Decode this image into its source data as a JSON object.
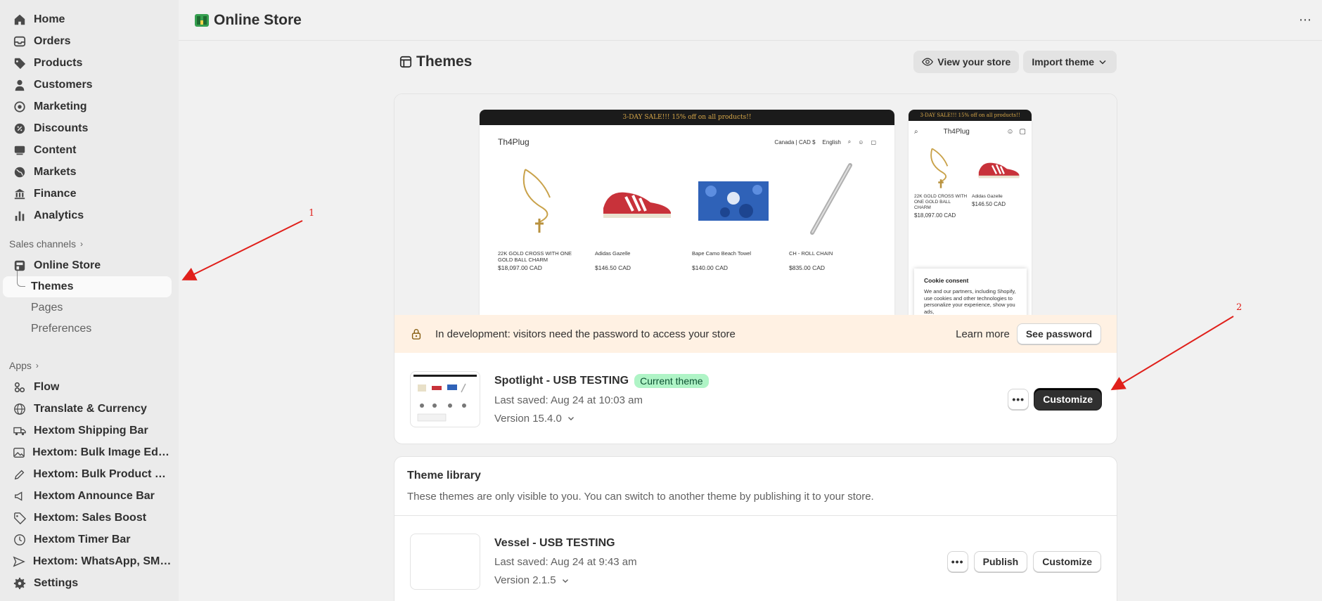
{
  "sidebar": {
    "main_items": [
      {
        "label": "Home",
        "icon": "home-icon"
      },
      {
        "label": "Orders",
        "icon": "orders-icon"
      },
      {
        "label": "Products",
        "icon": "tag-icon"
      },
      {
        "label": "Customers",
        "icon": "person-icon"
      },
      {
        "label": "Marketing",
        "icon": "target-icon"
      },
      {
        "label": "Discounts",
        "icon": "discount-icon"
      },
      {
        "label": "Content",
        "icon": "content-icon"
      },
      {
        "label": "Markets",
        "icon": "globe-icon"
      },
      {
        "label": "Finance",
        "icon": "bank-icon"
      },
      {
        "label": "Analytics",
        "icon": "bar-chart-icon"
      }
    ],
    "sales_channels_label": "Sales channels",
    "online_store_label": "Online Store",
    "sub_items": [
      "Themes",
      "Pages",
      "Preferences"
    ],
    "apps_label": "Apps",
    "apps": [
      "Flow",
      "Translate & Currency",
      "Hextom Shipping Bar",
      "Hextom: Bulk Image Edit &...",
      "Hextom: Bulk Product Edit",
      "Hextom Announce Bar",
      "Hextom: Sales Boost",
      "Hextom Timer Bar",
      "Hextom: WhatsApp, SMS ..."
    ],
    "settings_label": "Settings"
  },
  "topbar": {
    "title": "Online Store",
    "more": "⋯"
  },
  "page": {
    "title": "Themes",
    "view_store_label": "View your store",
    "import_theme_label": "Import theme"
  },
  "preview": {
    "announcement": "3-DAY SALE!!! 15% off on all products!!",
    "store_name": "Th4Plug",
    "currency": "Canada | CAD $",
    "language": "English",
    "products": [
      {
        "name": "22K GOLD CROSS WITH ONE GOLD BALL CHARM",
        "price": "$18,097.00 CAD"
      },
      {
        "name": "Adidas Gazelle",
        "price": "$146.50 CAD"
      },
      {
        "name": "Bape Camo Beach Towel",
        "price": "$140.00 CAD"
      },
      {
        "name": "CH - ROLL CHAIN",
        "price": "$835.00 CAD"
      }
    ],
    "cookie_title": "Cookie consent",
    "cookie_text": "We and our partners, including Shopify, use cookies and other technologies to personalize your experience, show you ads,"
  },
  "dev_banner": {
    "message": "In development: visitors need the password to access your store",
    "learn_more": "Learn more",
    "see_password": "See password"
  },
  "current_theme": {
    "name": "Spotlight - USB TESTING",
    "badge": "Current theme",
    "saved": "Last saved: Aug 24 at 10:03 am",
    "version": "Version 15.4.0",
    "customize_label": "Customize"
  },
  "library": {
    "title": "Theme library",
    "description": "These themes are only visible to you. You can switch to another theme by publishing it to your store.",
    "themes": [
      {
        "name": "Vessel - USB TESTING",
        "saved": "Last saved: Aug 24 at 9:43 am",
        "version": "Version 2.1.5",
        "publish_label": "Publish",
        "customize_label": "Customize"
      }
    ]
  },
  "annotations": [
    "1",
    "2"
  ],
  "colors": {
    "accent_badge": "#aff4c6",
    "banner": "#fff1e3",
    "annotation": "#e0201b",
    "primary_button": "#303030"
  }
}
